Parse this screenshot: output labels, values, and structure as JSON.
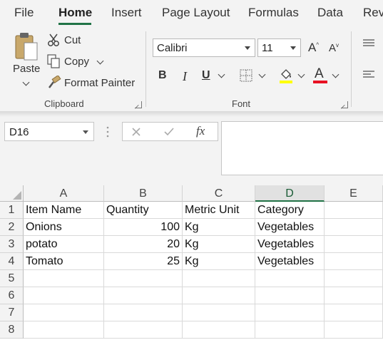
{
  "ribbon_tabs": [
    "File",
    "Home",
    "Insert",
    "Page Layout",
    "Formulas",
    "Data",
    "Rev"
  ],
  "active_tab": "Home",
  "clipboard": {
    "paste_label": "Paste",
    "cut_label": "Cut",
    "copy_label": "Copy",
    "format_painter_label": "Format Painter",
    "group_label": "Clipboard"
  },
  "font": {
    "name": "Calibri",
    "size": "11",
    "bold": "B",
    "italic": "I",
    "underline": "U",
    "font_color_glyph": "A",
    "group_label": "Font",
    "fill_color": "#ffff00",
    "font_color": "#e81123"
  },
  "formula_bar": {
    "name_box": "D16",
    "fx_label": "fx",
    "formula": ""
  },
  "sheet": {
    "column_headers": [
      "A",
      "B",
      "C",
      "D",
      "E"
    ],
    "selected_column": "D",
    "row_headers": [
      "1",
      "2",
      "3",
      "4",
      "5",
      "6",
      "7",
      "8"
    ],
    "rows": [
      [
        "Item Name",
        "Quantity",
        "Metric Unit",
        "Category",
        ""
      ],
      [
        "Onions",
        "100",
        "Kg",
        "Vegetables",
        ""
      ],
      [
        "potato",
        "20",
        "Kg",
        "Vegetables",
        ""
      ],
      [
        "Tomato",
        "25",
        "Kg",
        "Vegetables",
        ""
      ],
      [
        "",
        "",
        "",
        "",
        ""
      ],
      [
        "",
        "",
        "",
        "",
        ""
      ],
      [
        "",
        "",
        "",
        "",
        ""
      ],
      [
        "",
        "",
        "",
        "",
        ""
      ]
    ]
  },
  "colors": {
    "accent": "#217346",
    "ribbon_bg": "#f3f3f3"
  }
}
